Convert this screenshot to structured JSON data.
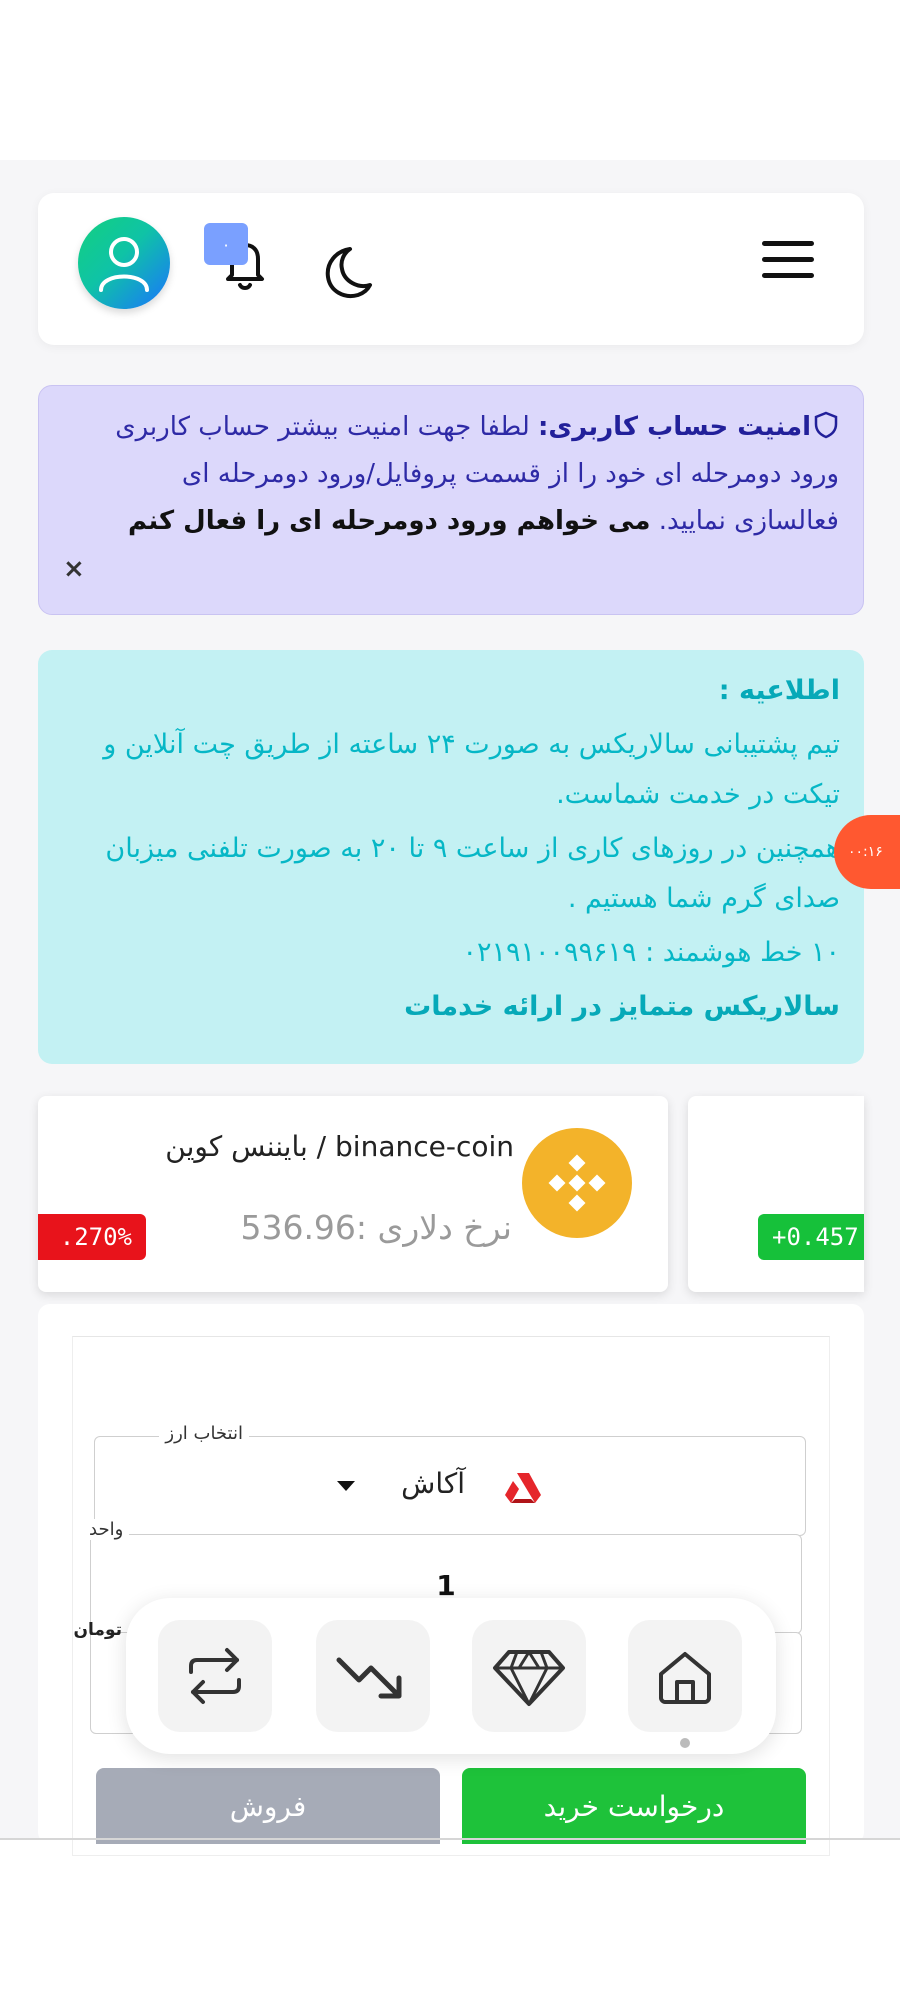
{
  "header": {
    "menu_icon": "hamburger-menu-icon",
    "theme_icon": "moon-icon",
    "notifications": {
      "icon": "bell-icon",
      "badge": "۰"
    },
    "avatar_icon": "user-icon"
  },
  "security_alert": {
    "title": "امنیت حساب کاربری:",
    "body": "لطفا جهت امنیت بیشتر حساب کاربری ورود دومرحله ای خود را از قسمت پروفایل/ورود دومرحله ای فعالسازی نمایید.",
    "link": "می خواهم ورود دومرحله ای را فعال کنم",
    "close": "×"
  },
  "notice": {
    "title": "اطلاعیه :",
    "line1": "تیم پشتیبانی سالاریکس به صورت ۲۴ ساعته از طریق چت آنلاین و تیکت در خدمت شماست.",
    "line2": "همچنین در روزهای کاری از ساعت ۹ تا ۲۰  به صورت تلفنی میزبان صدای گرم شما هستیم .",
    "line3": "۱۰ خط هوشمند : ۰۲۱۹۱۰۰۹۹۶۱۹",
    "footer": "سالاریکس متمایز در ارائه خدمات"
  },
  "side_timer": "۰۰:۱۶",
  "coins": {
    "main": {
      "name": "binance-coin / بایننس کوین",
      "rate": "نرخ دلاری :536.96",
      "change": ".270%",
      "logo_icon": "binance-logo-icon"
    },
    "next": {
      "change": "+0.457"
    }
  },
  "form": {
    "currency_label": "انتخاب ارز",
    "currency_value": "آکاش",
    "unit_label": "واحد",
    "unit_value": "1",
    "toman_label": "تومان",
    "buy_label": "درخواست خرید",
    "sell_label": "فروش"
  },
  "bottom_nav": [
    {
      "icon": "home-icon"
    },
    {
      "icon": "diamond-icon"
    },
    {
      "icon": "trend-down-icon"
    },
    {
      "icon": "swap-icon"
    }
  ],
  "colors": {
    "security_bg": "#dcd8fb",
    "notice_bg": "#c3f1f3",
    "buy": "#1ec23a",
    "sell": "#a6abb7",
    "negative": "#e8131b",
    "positive": "#16c13a"
  }
}
